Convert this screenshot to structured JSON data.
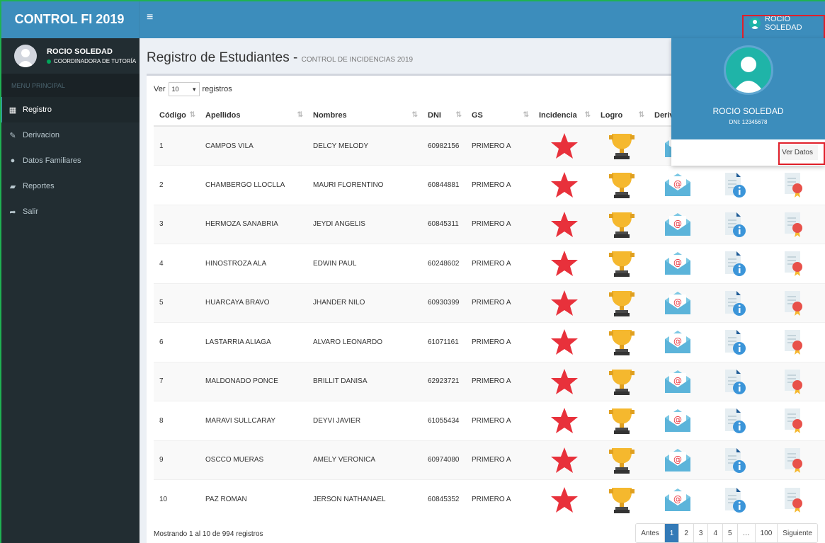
{
  "app": {
    "title": "CONTROL FI 2019"
  },
  "header": {
    "menu_icon": "hamburger-icon",
    "user_name": "ROCIO SOLEDAD"
  },
  "sidebar": {
    "user_name": "ROCIO SOLEDAD",
    "user_role": "COORDINADORA DE TUTORÍA",
    "menu_header": "MENU PRINCIPAL",
    "items": [
      {
        "label": "Registro",
        "icon": "table-icon",
        "active": true
      },
      {
        "label": "Derivacion",
        "icon": "edit-icon"
      },
      {
        "label": "Datos Familiares",
        "icon": "user-icon"
      },
      {
        "label": "Reportes",
        "icon": "book-icon"
      },
      {
        "label": "Salir",
        "icon": "share-icon"
      }
    ]
  },
  "page": {
    "title": "Registro de Estudiantes - ",
    "subtitle": "CONTROL DE INCIDENCIAS 2019"
  },
  "table": {
    "length_prefix": "Ver",
    "length_value": "10",
    "length_suffix": "registros",
    "columns": [
      "Código",
      "Apellidos",
      "Nombres",
      "DNI",
      "GS",
      "Incidencia",
      "Logro",
      "Deriv",
      "",
      ""
    ],
    "rows": [
      {
        "codigo": "1",
        "apellidos": "CAMPOS VILA",
        "nombres": "DELCY MELODY",
        "dni": "60982156",
        "gs": "PRIMERO A"
      },
      {
        "codigo": "2",
        "apellidos": "CHAMBERGO LLOCLLA",
        "nombres": "MAURI FLORENTINO",
        "dni": "60844881",
        "gs": "PRIMERO A"
      },
      {
        "codigo": "3",
        "apellidos": "HERMOZA SANABRIA",
        "nombres": "JEYDI ANGELIS",
        "dni": "60845311",
        "gs": "PRIMERO A"
      },
      {
        "codigo": "4",
        "apellidos": "HINOSTROZA ALA",
        "nombres": "EDWIN PAUL",
        "dni": "60248602",
        "gs": "PRIMERO A"
      },
      {
        "codigo": "5",
        "apellidos": "HUARCAYA BRAVO",
        "nombres": "JHANDER NILO",
        "dni": "60930399",
        "gs": "PRIMERO A"
      },
      {
        "codigo": "6",
        "apellidos": "LASTARRIA ALIAGA",
        "nombres": "ALVARO LEONARDO",
        "dni": "61071161",
        "gs": "PRIMERO A"
      },
      {
        "codigo": "7",
        "apellidos": "MALDONADO PONCE",
        "nombres": "BRILLIT DANISA",
        "dni": "62923721",
        "gs": "PRIMERO A"
      },
      {
        "codigo": "8",
        "apellidos": "MARAVI SULLCARAY",
        "nombres": "DEYVI JAVIER",
        "dni": "61055434",
        "gs": "PRIMERO A"
      },
      {
        "codigo": "9",
        "apellidos": "OSCCO MUERAS",
        "nombres": "AMELY VERONICA",
        "dni": "60974080",
        "gs": "PRIMERO A"
      },
      {
        "codigo": "10",
        "apellidos": "PAZ ROMAN",
        "nombres": "JERSON NATHANAEL",
        "dni": "60845352",
        "gs": "PRIMERO A"
      }
    ],
    "info": "Mostrando 1 al 10 de 994 registros",
    "pagination": [
      "Antes",
      "1",
      "2",
      "3",
      "4",
      "5",
      "…",
      "100",
      "Siguiente"
    ],
    "current_page": "1"
  },
  "dropdown": {
    "name": "ROCIO SOLEDAD",
    "dni": "DNI: 12345678",
    "button": "Ver Datos"
  },
  "colors": {
    "primary": "#3c8dbc",
    "sidebar": "#222d32",
    "highlight": "#e01f2a",
    "star": "#e8313b",
    "trophy": "#f5b82e"
  }
}
